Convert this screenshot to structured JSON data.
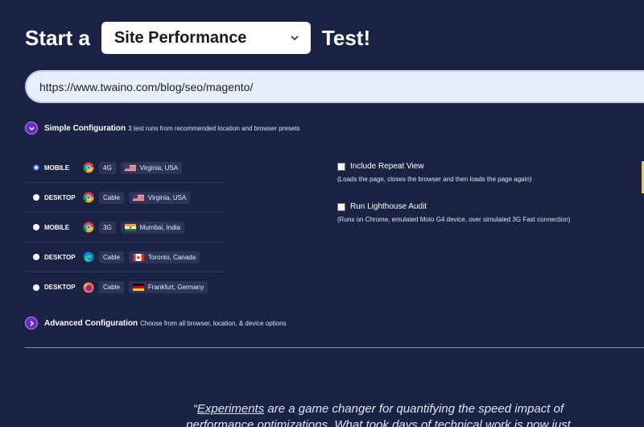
{
  "header": {
    "prefix": "Start a",
    "suffix": "Test!",
    "test_type_selected": "Site Performance"
  },
  "url_input": {
    "value": "https://www.twaino.com/blog/seo/magento/"
  },
  "simple_config": {
    "title": "Simple Configuration",
    "desc": "3 test runs from recommended location and browser presets",
    "expanded": true
  },
  "presets": [
    {
      "device": "MOBILE",
      "browser_icon": "chrome-icon",
      "connection": "4G",
      "flag": "usa-flag-icon",
      "location": "Virginia, USA",
      "selected": true
    },
    {
      "device": "DESKTOP",
      "browser_icon": "chrome-icon",
      "connection": "Cable",
      "flag": "usa-flag-icon",
      "location": "Virginia, USA",
      "selected": false
    },
    {
      "device": "MOBILE",
      "browser_icon": "chrome-icon",
      "connection": "3G",
      "flag": "india-flag-icon",
      "location": "Mumbai, India",
      "selected": false
    },
    {
      "device": "DESKTOP",
      "browser_icon": "edge-icon",
      "connection": "Cable",
      "flag": "canada-flag-icon",
      "location": "Toronto, Canada",
      "selected": false
    },
    {
      "device": "DESKTOP",
      "browser_icon": "firefox-icon",
      "connection": "Cable",
      "flag": "germany-flag-icon",
      "location": "Frankfurt, Germany",
      "selected": false
    }
  ],
  "options": {
    "repeat_view": {
      "label": "Include Repeat View",
      "desc": "(Loads the page, closes the browser and then loads the page again)"
    },
    "lighthouse": {
      "label": "Run Lighthouse Audit",
      "desc": "(Runs on Chrome, emulated Moto G4 device, over simulated 3G Fast connection)"
    }
  },
  "advanced_config": {
    "title": "Advanced Configuration",
    "desc": "Choose from all browser, location, & device options"
  },
  "quote": {
    "open": "“",
    "link": "Experiments",
    "text": " are a game changer for quantifying the speed impact of performance optimizations. What took days of technical work is now just"
  },
  "colors": {
    "background": "#1b2345",
    "accent_purple": "#6b2bbf",
    "tag_bg": "#2c3559"
  }
}
